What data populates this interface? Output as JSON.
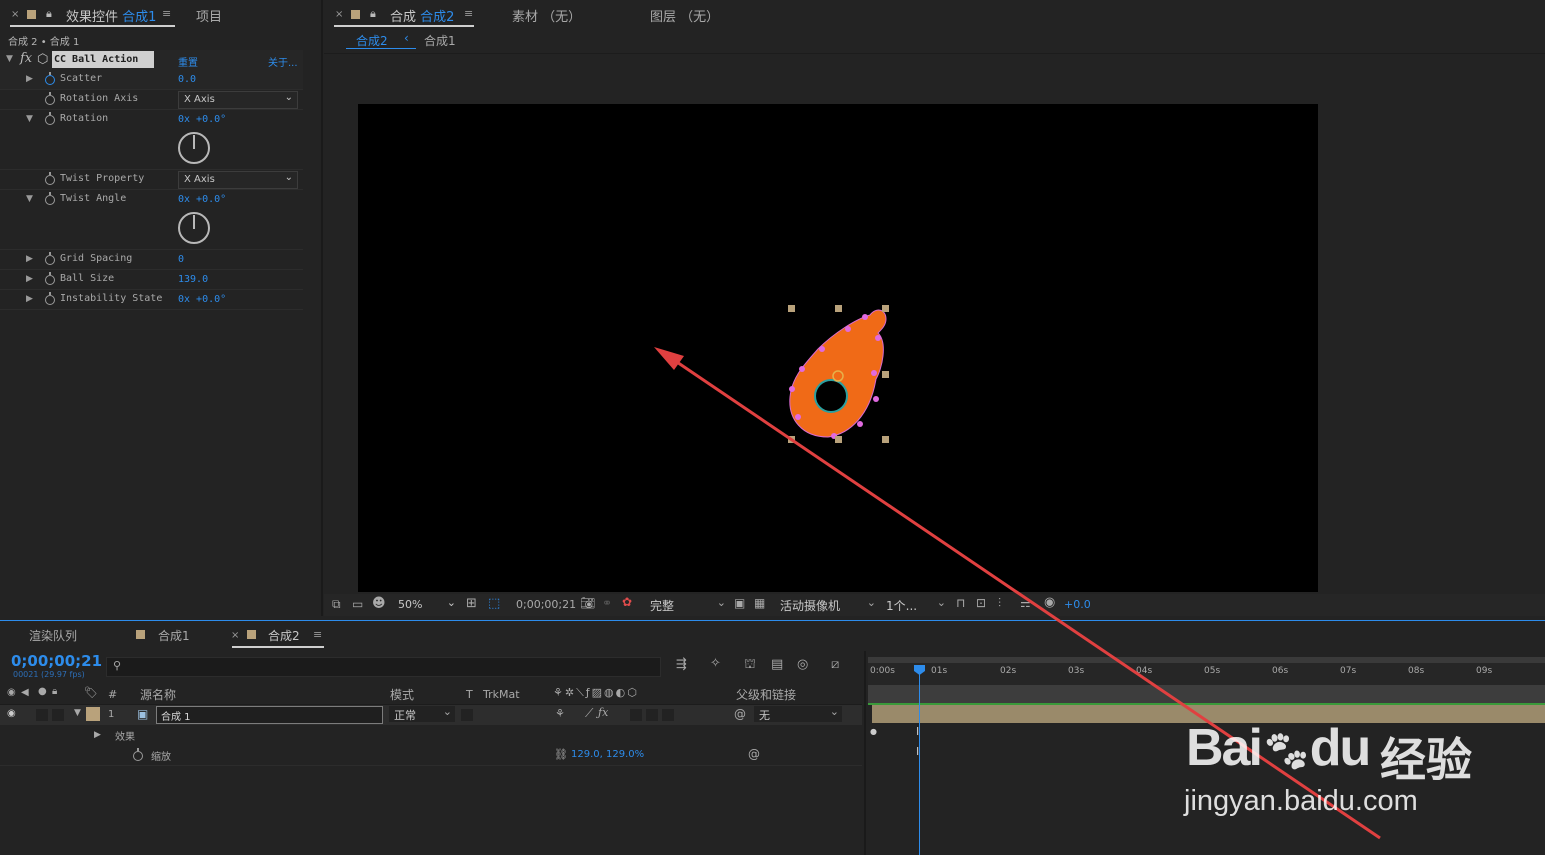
{
  "effects_panel": {
    "tab_close": "×",
    "tab_label": "效果控件",
    "tab_comp": "合成1",
    "project_tab": "项目",
    "breadcrumb": "合成 2 • 合成 1",
    "effect_name": "CC Ball Action",
    "reset_label": "重置",
    "about_label": "关于...",
    "properties": [
      {
        "label": "Scatter",
        "value": "0.0"
      },
      {
        "label": "Rotation Axis",
        "value": "X Axis"
      },
      {
        "label": "Rotation",
        "value": "0x +0.0°"
      },
      {
        "label": "Twist Property",
        "value": "X Axis"
      },
      {
        "label": "Twist Angle",
        "value": "0x +0.0°"
      },
      {
        "label": "Grid Spacing",
        "value": "0"
      },
      {
        "label": "Ball Size",
        "value": "139.0"
      },
      {
        "label": "Instability State",
        "value": "0x +0.0°"
      }
    ]
  },
  "viewer": {
    "tab_close": "×",
    "tab_label": "合成",
    "tab_comp": "合成2",
    "footage_tab": "素材 （无）",
    "layer_tab": "图层 （无）",
    "breadcrumb_active": "合成2",
    "breadcrumb_sep": "‹",
    "breadcrumb_next": "合成1",
    "zoom": "50%",
    "timecode": "0;00;00;21",
    "resolution": "完整",
    "camera": "活动摄像机",
    "views": "1个...",
    "exposure": "+0.0"
  },
  "timeline": {
    "tabs": [
      "渲染队列",
      "合成1",
      "合成2"
    ],
    "close": "×",
    "timecode": "0;00;00;21",
    "frame_info": "00021 (29.97 fps)",
    "search_placeholder": "",
    "columns": {
      "num": "#",
      "source": "源名称",
      "mode": "模式",
      "t": "T",
      "trkmat": "TrkMat",
      "parent": "父级和链接"
    },
    "layer": {
      "index": "1",
      "name": "合成 1",
      "mode": "正常",
      "parent": "无"
    },
    "effects_group": "效果",
    "scale_label": "缩放",
    "scale_value": "129.0, 129.0%",
    "ruler": [
      "0:00s",
      "01s",
      "02s",
      "03s",
      "04s",
      "05s",
      "06s",
      "07s",
      "08s",
      "09s"
    ]
  },
  "watermark": {
    "brand": "Bai",
    "brand2": "du",
    "cn": "经验",
    "url": "jingyan.baidu.com"
  },
  "colors": {
    "accent": "#2d8ceb",
    "shape": "#f06a17",
    "arrow": "#e04040",
    "label": "#b9a27b"
  }
}
